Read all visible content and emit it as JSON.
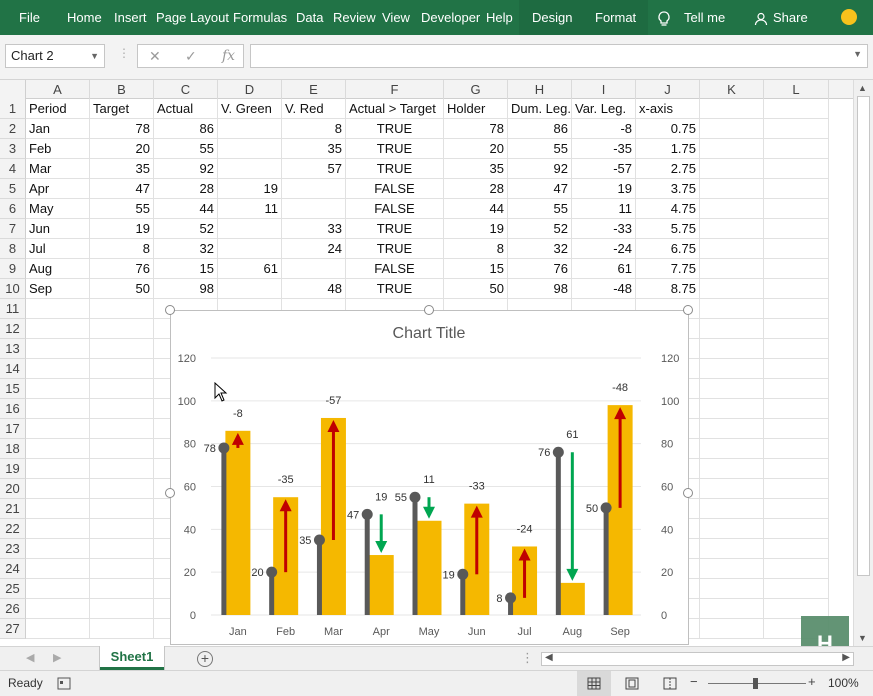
{
  "ribbon": {
    "tabs": [
      "File",
      "Home",
      "Insert",
      "Page Layout",
      "Formulas",
      "Data",
      "Review",
      "View",
      "Developer",
      "Help",
      "Design",
      "Format"
    ],
    "tell_me": "Tell me",
    "share": "Share"
  },
  "namebox": {
    "value": "Chart 2"
  },
  "formula": {
    "value": ""
  },
  "columns": [
    "A",
    "B",
    "C",
    "D",
    "E",
    "F",
    "G",
    "H",
    "I",
    "J",
    "K",
    "L"
  ],
  "rows": [
    "1",
    "2",
    "3",
    "4",
    "5",
    "6",
    "7",
    "8",
    "9",
    "10",
    "11",
    "12",
    "13",
    "14",
    "15",
    "16",
    "17",
    "18",
    "19",
    "20",
    "21",
    "22",
    "23",
    "24",
    "25",
    "26",
    "27"
  ],
  "sheet": {
    "headers": [
      "Period",
      "Target",
      "Actual",
      "V. Green",
      "V. Red",
      "Actual > Target",
      "Holder",
      "Dum. Leg.",
      "Var. Leg.",
      "x-axis"
    ],
    "data": [
      [
        "Jan",
        "78",
        "86",
        "",
        "8",
        "TRUE",
        "78",
        "86",
        "-8",
        "0.75"
      ],
      [
        "Feb",
        "20",
        "55",
        "",
        "35",
        "TRUE",
        "20",
        "55",
        "-35",
        "1.75"
      ],
      [
        "Mar",
        "35",
        "92",
        "",
        "57",
        "TRUE",
        "35",
        "92",
        "-57",
        "2.75"
      ],
      [
        "Apr",
        "47",
        "28",
        "19",
        "",
        "FALSE",
        "28",
        "47",
        "19",
        "3.75"
      ],
      [
        "May",
        "55",
        "44",
        "11",
        "",
        "FALSE",
        "44",
        "55",
        "11",
        "4.75"
      ],
      [
        "Jun",
        "19",
        "52",
        "",
        "33",
        "TRUE",
        "19",
        "52",
        "-33",
        "5.75"
      ],
      [
        "Jul",
        "8",
        "32",
        "",
        "24",
        "TRUE",
        "8",
        "32",
        "-24",
        "6.75"
      ],
      [
        "Aug",
        "76",
        "15",
        "61",
        "",
        "FALSE",
        "15",
        "76",
        "61",
        "7.75"
      ],
      [
        "Sep",
        "50",
        "98",
        "",
        "48",
        "TRUE",
        "50",
        "98",
        "-48",
        "8.75"
      ]
    ]
  },
  "chart_data": {
    "type": "bar",
    "title": "Chart Title",
    "categories": [
      "Jan",
      "Feb",
      "Mar",
      "Apr",
      "May",
      "Jun",
      "Jul",
      "Aug",
      "Sep"
    ],
    "series": [
      {
        "name": "Actual",
        "values": [
          86,
          55,
          92,
          28,
          44,
          52,
          32,
          15,
          98
        ]
      },
      {
        "name": "Target",
        "values": [
          78,
          20,
          35,
          47,
          55,
          19,
          8,
          76,
          50
        ]
      }
    ],
    "variance_labels": [
      "-8",
      "-35",
      "-57",
      "19",
      "11",
      "-33",
      "-24",
      "61",
      "-48"
    ],
    "target_labels": [
      "78",
      "20",
      "35",
      "47",
      "55",
      "19",
      "8",
      "76",
      "50"
    ],
    "ylim": [
      0,
      120
    ],
    "yticks": [
      "0",
      "20",
      "40",
      "60",
      "80",
      "100",
      "120"
    ],
    "colors": {
      "bar": "#f5b800",
      "stick": "#595959",
      "up_arrow": "#c00000",
      "down_arrow": "#00a651",
      "grid": "#e6e6e6"
    }
  },
  "sheet_tab": "Sheet1",
  "status": {
    "ready": "Ready",
    "zoom": "100%"
  },
  "logo": "H"
}
